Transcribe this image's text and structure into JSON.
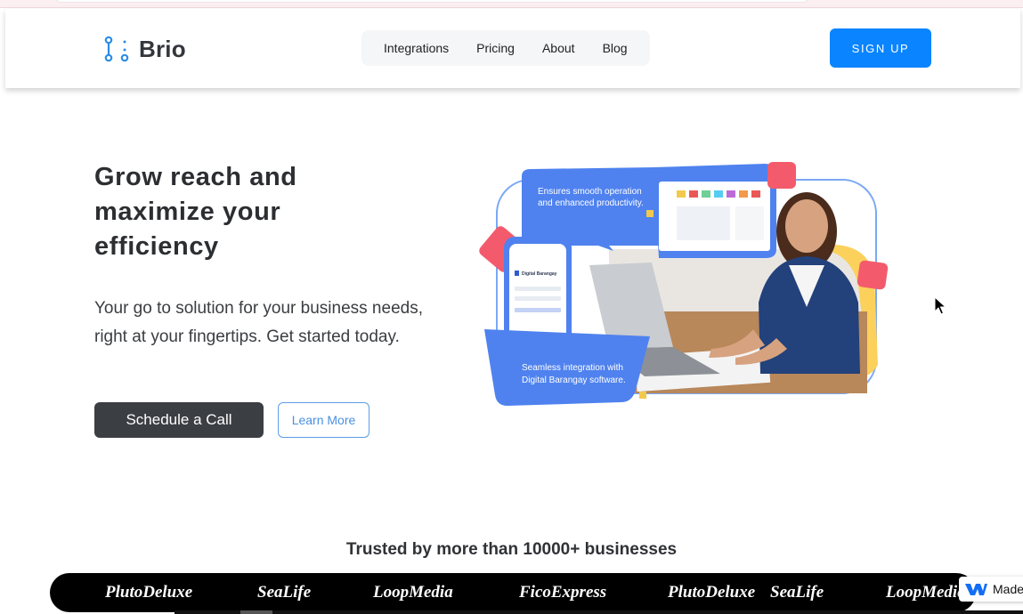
{
  "brand": {
    "name": "Brio",
    "accent": "#0a84ff"
  },
  "nav": {
    "links": [
      "Integrations",
      "Pricing",
      "About",
      "Blog"
    ],
    "signup_label": "SIGN UP"
  },
  "hero": {
    "title": "Grow reach and maximize your efficiency",
    "subtitle": "Your go to solution for your business needs, right at your fingertips. Get started today.",
    "primary_cta": "Schedule a Call",
    "secondary_cta": "Learn More",
    "art": {
      "bubble_top": [
        "Ensures smooth operation",
        "and enhanced productivity."
      ],
      "bubble_bottom": [
        "Seamless integration with",
        "Digital Barangay software."
      ],
      "phone_app_title": "Digital Barangay"
    }
  },
  "trusted": {
    "heading": "Trusted by more than 10000+ businesses",
    "logos": [
      "PlutoDeluxe",
      "SeaLife",
      "LoopMedia",
      "FicoExpress",
      "PlutoDeluxe",
      "SeaLife",
      "LoopMedia"
    ]
  },
  "badge": {
    "label": "Made"
  }
}
